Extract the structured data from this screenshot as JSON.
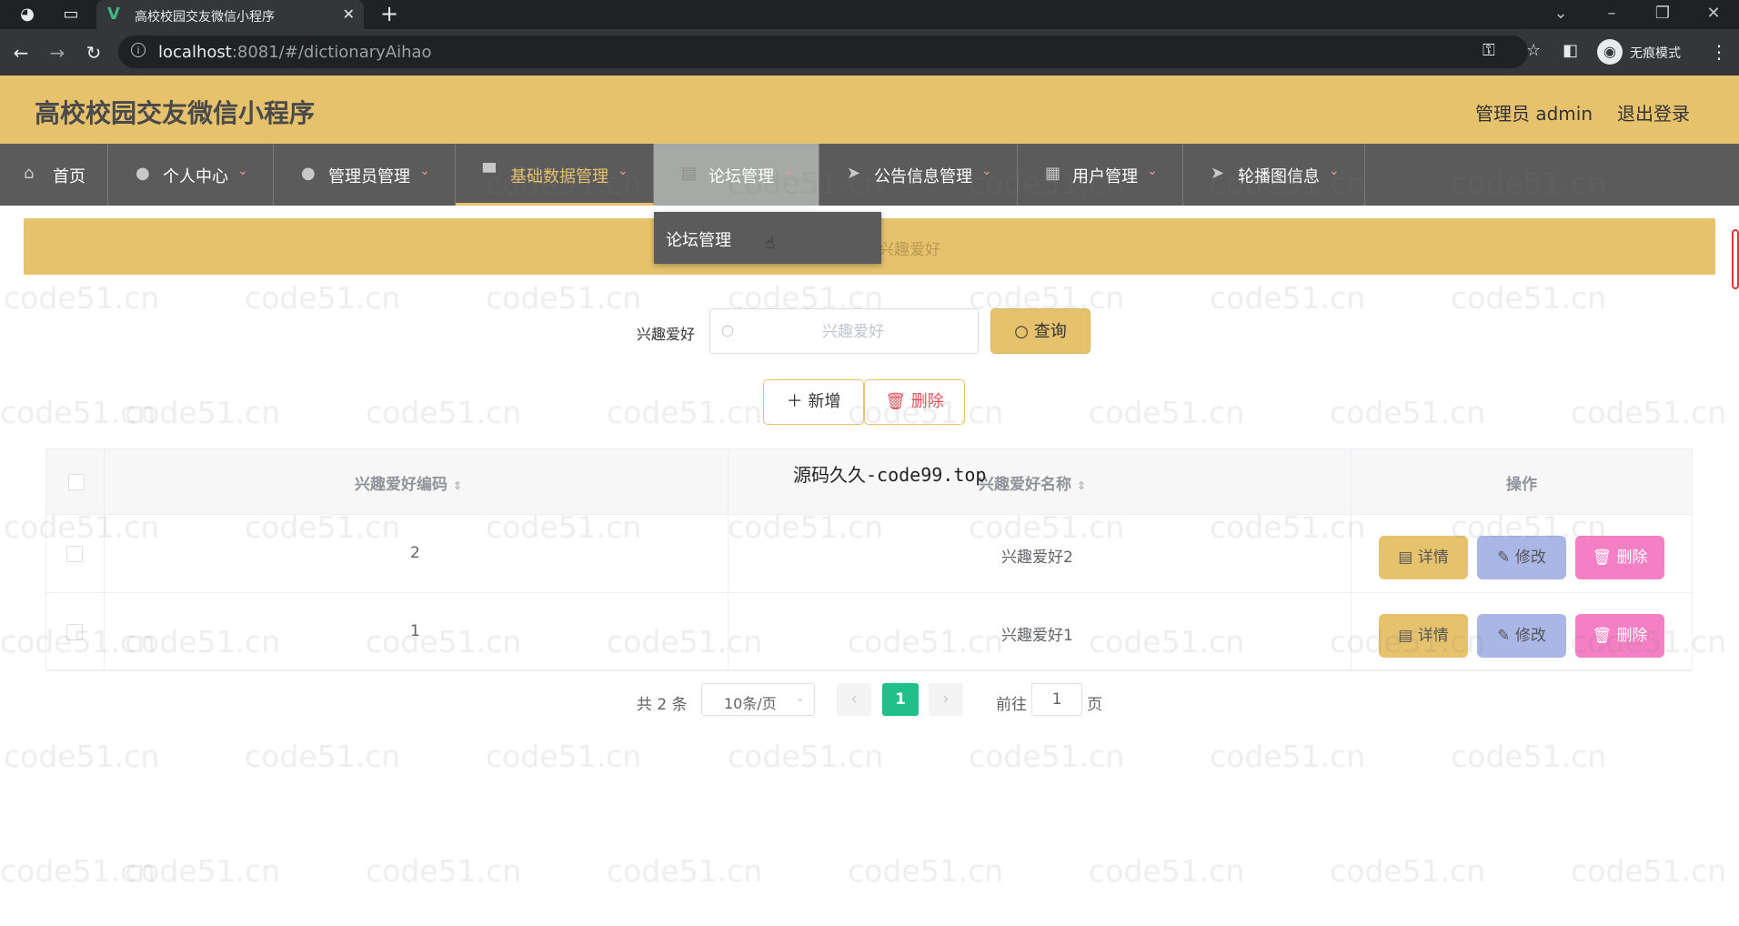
{
  "browser": {
    "tab_title": "高校校园交友微信小程序",
    "tab_favicon": "V",
    "url_host": "localhost",
    "url_path": ":8081/#/dictionaryAihao",
    "incognito_label": "无痕模式"
  },
  "app": {
    "title": "高校校园交友微信小程序",
    "admin_label": "管理员 admin",
    "logout_label": "退出登录"
  },
  "menu": {
    "items": [
      {
        "label": "首页",
        "icon": "home-icon"
      },
      {
        "label": "个人中心",
        "icon": "user-icon"
      },
      {
        "label": "管理员管理",
        "icon": "user-icon"
      },
      {
        "label": "基础数据管理",
        "icon": "stamp-icon"
      },
      {
        "label": "论坛管理",
        "icon": "forum-icon"
      },
      {
        "label": "公告信息管理",
        "icon": "send-icon"
      },
      {
        "label": "用户管理",
        "icon": "document-icon"
      },
      {
        "label": "轮播图信息",
        "icon": "send-icon"
      }
    ],
    "active_index": 3,
    "hover_index": 4,
    "dropdown_item": "论坛管理"
  },
  "breadcrumb": {
    "current": "兴趣爱好"
  },
  "search": {
    "label": "兴趣爱好",
    "placeholder": "兴趣爱好",
    "query_button": "查询"
  },
  "actions": {
    "add": "新增",
    "delete": "删除"
  },
  "table": {
    "columns": [
      "兴趣爱好编码",
      "兴趣爱好名称",
      "操作"
    ],
    "rows": [
      {
        "code": "2",
        "name": "兴趣爱好2"
      },
      {
        "code": "1",
        "name": "兴趣爱好1"
      }
    ],
    "row_actions": {
      "detail": "详情",
      "edit": "修改",
      "delete": "删除"
    }
  },
  "pagination": {
    "total": "共 2 条",
    "page_size": "10条/页",
    "current_page": "1",
    "goto_label": "前往",
    "goto_value": "1",
    "page_unit": "页"
  },
  "overlay_text": "源码久久-code99.top",
  "watermark": "code51.cn",
  "colors": {
    "accent": "#e6c26d",
    "menu_bg": "#5b5b5b",
    "edit": "#a9b6e6",
    "remove": "#f47fc4",
    "page_active": "#21c08b"
  }
}
